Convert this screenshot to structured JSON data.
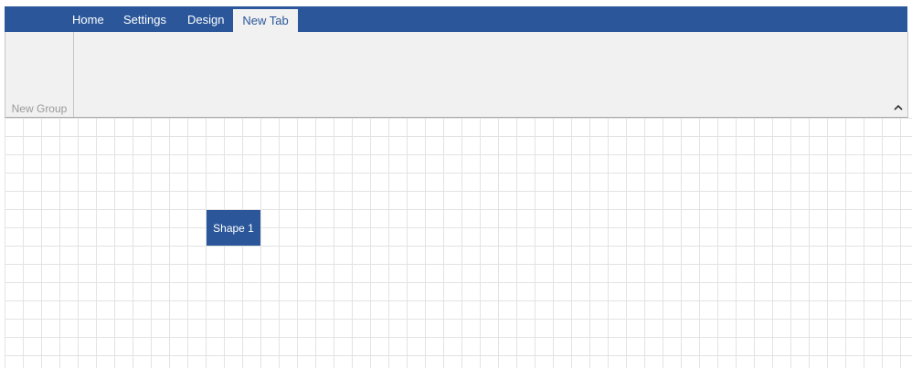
{
  "ribbon": {
    "tabs": [
      {
        "label": "Home"
      },
      {
        "label": "Settings"
      },
      {
        "label": "Design"
      },
      {
        "label": "New Tab",
        "selected": true
      }
    ],
    "groups": [
      {
        "label": "New Group"
      }
    ],
    "collapse_icon": "chevron-up-icon"
  },
  "canvas": {
    "shapes": [
      {
        "label": "Shape 1",
        "fill": "#2b579a"
      }
    ]
  },
  "colors": {
    "accent": "#2b579a",
    "ribbon_bg": "#f1f1f1",
    "grid_line": "#e3e3e3"
  }
}
